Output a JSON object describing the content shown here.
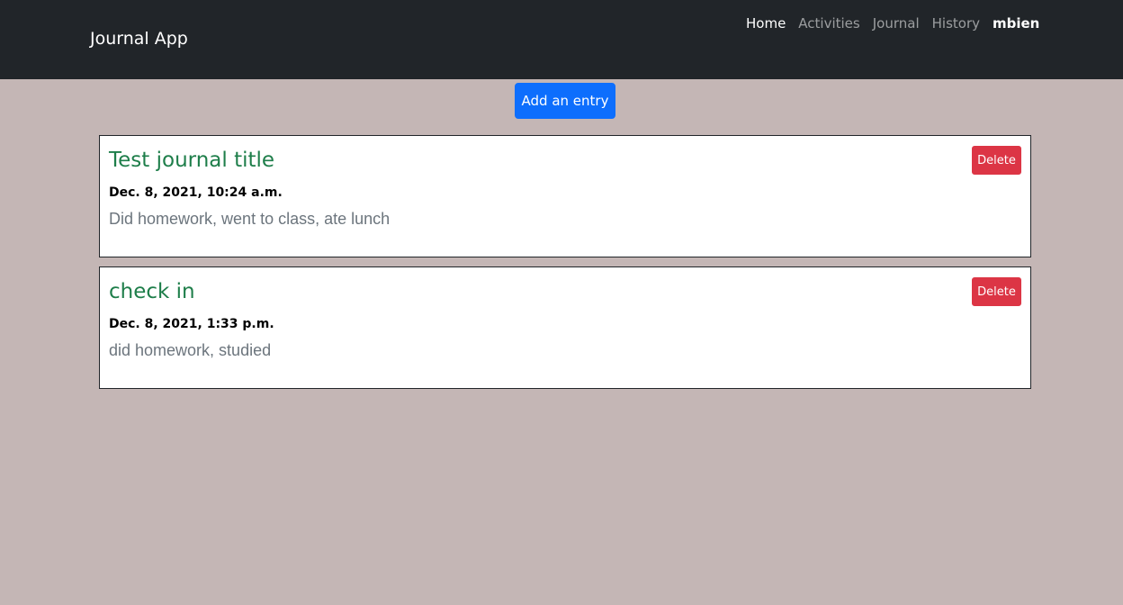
{
  "navbar": {
    "brand": "Journal App",
    "links": [
      {
        "label": "Home",
        "active": true
      },
      {
        "label": "Activities",
        "active": false
      },
      {
        "label": "Journal",
        "active": false
      },
      {
        "label": "History",
        "active": false
      }
    ],
    "user": "mbien"
  },
  "actions": {
    "add_label": "Add an entry"
  },
  "entries": [
    {
      "title": "Test journal title",
      "date": "Dec. 8, 2021, 10:24 a.m.",
      "body": "Did homework, went to class, ate lunch",
      "delete_label": "Delete"
    },
    {
      "title": "check in",
      "date": "Dec. 8, 2021, 1:33 p.m.",
      "body": "did homework, studied",
      "delete_label": "Delete"
    }
  ],
  "colors": {
    "page_bg": "#c4b6b5",
    "navbar_bg": "#212529",
    "primary": "#0d6efd",
    "danger": "#dc3545",
    "title_green": "#1e7e4a"
  }
}
